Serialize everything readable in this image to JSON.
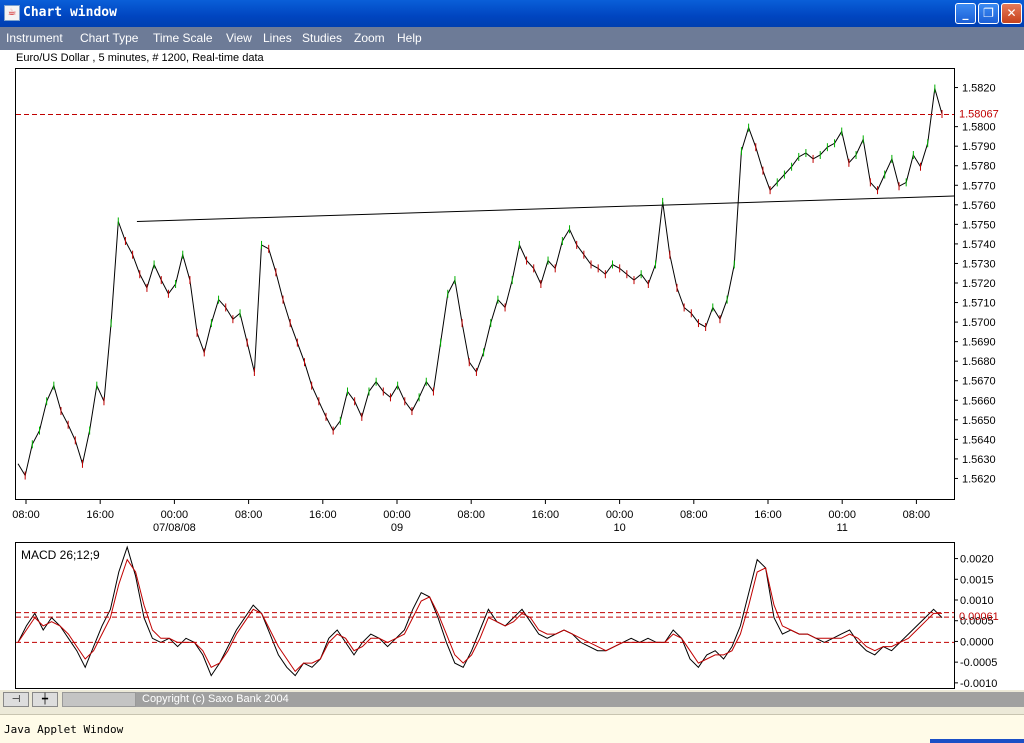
{
  "window": {
    "title": "Chart window"
  },
  "menu": [
    "Instrument",
    "Chart Type",
    "Time Scale",
    "View",
    "Lines",
    "Studies",
    "Zoom",
    "Help"
  ],
  "chart_data": [
    {
      "type": "line",
      "title": "Euro/US Dollar , 5 minutes, # 1200, Real-time data",
      "ylim": [
        1.561,
        1.583
      ],
      "y_ticks": [
        "1.5820",
        "1.5800",
        "1.5790",
        "1.5780",
        "1.5770",
        "1.5760",
        "1.5750",
        "1.5740",
        "1.5730",
        "1.5720",
        "1.5710",
        "1.5700",
        "1.5690",
        "1.5680",
        "1.5670",
        "1.5660",
        "1.5650",
        "1.5640",
        "1.5630",
        "1.5620"
      ],
      "current_price_label": "1.58067",
      "current_price": 1.58067,
      "x_tick_times": [
        "08:00",
        "16:00",
        "00:00",
        "08:00",
        "16:00",
        "00:00",
        "08:00",
        "16:00",
        "00:00",
        "08:00",
        "16:00",
        "00:00",
        "08:00"
      ],
      "x_tick_dates": [
        "07/08/08",
        "09",
        "10",
        "11"
      ],
      "trendline": [
        [
          1.5752,
          1.576
        ],
        [
          1.5765,
          1.5765
        ]
      ],
      "series": [
        {
          "values": [
            1.5628,
            1.5622,
            1.5638,
            1.5645,
            1.566,
            1.5668,
            1.5655,
            1.5648,
            1.564,
            1.5628,
            1.5645,
            1.5668,
            1.566,
            1.57,
            1.5752,
            1.5742,
            1.5735,
            1.5725,
            1.5718,
            1.573,
            1.5722,
            1.5715,
            1.572,
            1.5735,
            1.5722,
            1.5695,
            1.5685,
            1.57,
            1.5712,
            1.5708,
            1.5702,
            1.5705,
            1.569,
            1.5675,
            1.574,
            1.5738,
            1.5726,
            1.5712,
            1.57,
            1.569,
            1.568,
            1.5668,
            1.566,
            1.5652,
            1.5645,
            1.565,
            1.5665,
            1.566,
            1.5652,
            1.5665,
            1.567,
            1.5665,
            1.5662,
            1.5668,
            1.566,
            1.5655,
            1.5662,
            1.567,
            1.5665,
            1.569,
            1.5715,
            1.5722,
            1.57,
            1.568,
            1.5675,
            1.5685,
            1.57,
            1.5712,
            1.5708,
            1.5722,
            1.574,
            1.5732,
            1.5728,
            1.572,
            1.5732,
            1.5728,
            1.5742,
            1.5748,
            1.574,
            1.5735,
            1.573,
            1.5728,
            1.5725,
            1.573,
            1.5728,
            1.5725,
            1.5722,
            1.5725,
            1.572,
            1.573,
            1.5762,
            1.5735,
            1.5718,
            1.5708,
            1.5705,
            1.57,
            1.5698,
            1.5708,
            1.5702,
            1.5712,
            1.573,
            1.5788,
            1.58,
            1.579,
            1.5778,
            1.5768,
            1.5772,
            1.5776,
            1.578,
            1.5785,
            1.5787,
            1.5784,
            1.5786,
            1.579,
            1.5792,
            1.5798,
            1.5782,
            1.5786,
            1.5794,
            1.5772,
            1.5768,
            1.5776,
            1.5784,
            1.577,
            1.5772,
            1.5786,
            1.578,
            1.5792,
            1.582,
            1.5807
          ]
        }
      ]
    },
    {
      "type": "line",
      "title": "MACD 26;12;9",
      "ylim": [
        -0.0011,
        0.0024
      ],
      "y_ticks": [
        "0.0020",
        "0.0015",
        "0.0010",
        "0.0005",
        "0.0000",
        "-0.0005",
        "-0.0010"
      ],
      "current_value_label": "0.00061",
      "current_value": 0.00061,
      "signal_level": 0.00072,
      "zero_level": 0.0,
      "series": [
        {
          "values": [
            0.0,
            0.0004,
            0.0007,
            0.0003,
            0.0006,
            0.0004,
            0.0001,
            -0.0002,
            -0.0006,
            -0.0001,
            0.0004,
            0.0008,
            0.0017,
            0.0023,
            0.0016,
            0.0006,
            0.0001,
            0.0,
            0.0001,
            -0.0001,
            0.0001,
            0.0,
            -0.0003,
            -0.0008,
            -0.0005,
            -0.0001,
            0.0003,
            0.0006,
            0.0009,
            0.0007,
            0.0002,
            -0.0003,
            -0.0006,
            -0.0008,
            -0.0005,
            -0.0006,
            -0.0004,
            0.0001,
            0.0003,
            0.0,
            -0.0003,
            0.0,
            0.0002,
            0.0001,
            -0.0001,
            0.0001,
            0.0003,
            0.0008,
            0.0012,
            0.0011,
            0.0006,
            0.0,
            -0.0005,
            -0.0006,
            -0.0002,
            0.0003,
            0.0008,
            0.0005,
            0.0004,
            0.0006,
            0.0008,
            0.0005,
            0.0002,
            0.0001,
            0.0002,
            0.0003,
            0.0002,
            0.0,
            -0.0001,
            -0.0002,
            -0.0002,
            -0.0001,
            0.0,
            0.0001,
            0.0,
            0.0001,
            0.0,
            0.0,
            0.0003,
            0.0001,
            -0.0004,
            -0.0006,
            -0.0003,
            -0.0002,
            -0.0004,
            -0.0001,
            0.0004,
            0.0012,
            0.002,
            0.0018,
            0.0006,
            0.0002,
            0.0003,
            0.0002,
            0.0002,
            0.0001,
            0.0,
            0.0001,
            0.0002,
            0.0003,
            0.0,
            -0.0002,
            -0.0003,
            -0.0001,
            -0.0002,
            0.0,
            0.0002,
            0.0004,
            0.0006,
            0.0008,
            0.0006
          ]
        },
        {
          "values": [
            0.0,
            0.0003,
            0.0006,
            0.0004,
            0.0005,
            0.0004,
            0.0002,
            -0.0001,
            -0.0004,
            -0.0002,
            0.0002,
            0.0006,
            0.0014,
            0.002,
            0.0017,
            0.0009,
            0.0003,
            0.0001,
            0.0001,
            0.0,
            0.0,
            0.0,
            -0.0002,
            -0.0006,
            -0.0005,
            -0.0002,
            0.0002,
            0.0005,
            0.0008,
            0.0007,
            0.0003,
            -0.0001,
            -0.0004,
            -0.0007,
            -0.0005,
            -0.0005,
            -0.0004,
            0.0,
            0.0002,
            0.0001,
            -0.0002,
            -0.0001,
            0.0001,
            0.0001,
            0.0,
            0.0001,
            0.0002,
            0.0006,
            0.001,
            0.0011,
            0.0007,
            0.0002,
            -0.0003,
            -0.0005,
            -0.0003,
            0.0001,
            0.0006,
            0.0005,
            0.0004,
            0.0005,
            0.0007,
            0.0006,
            0.0003,
            0.0002,
            0.0002,
            0.0003,
            0.0002,
            0.0001,
            0.0,
            -0.0001,
            -0.0002,
            -0.0001,
            0.0,
            0.0,
            0.0,
            0.0,
            0.0,
            0.0,
            0.0002,
            0.0001,
            -0.0002,
            -0.0005,
            -0.0004,
            -0.0003,
            -0.0003,
            -0.0002,
            0.0002,
            0.0009,
            0.0017,
            0.0018,
            0.0009,
            0.0004,
            0.0003,
            0.0002,
            0.0002,
            0.0001,
            0.0001,
            0.0001,
            0.0001,
            0.0002,
            0.0001,
            -0.0001,
            -0.0002,
            -0.0001,
            -0.0001,
            0.0,
            0.0001,
            0.0003,
            0.0005,
            0.0007,
            0.0007
          ]
        }
      ]
    }
  ],
  "status": {
    "copyright": "Copyright (c) Saxo Bank 2004",
    "applet_label": "Java Applet Window"
  }
}
